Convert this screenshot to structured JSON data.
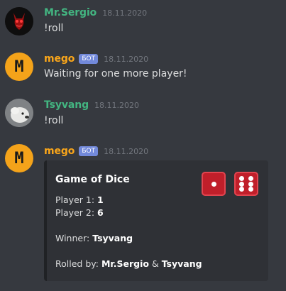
{
  "messages": [
    {
      "username": "Mr.Sergio",
      "username_color": "#43b581",
      "timestamp": "18.11.2020",
      "text": "!roll"
    },
    {
      "username": "mego",
      "username_color": "#faa61a",
      "bot_badge": "БОТ",
      "timestamp": "18.11.2020",
      "text": "Waiting for one more player!"
    },
    {
      "username": "Tsyvang",
      "username_color": "#43b581",
      "timestamp": "18.11.2020",
      "text": "!roll"
    },
    {
      "username": "mego",
      "username_color": "#faa61a",
      "bot_badge": "БОТ",
      "timestamp": "18.11.2020"
    }
  ],
  "embed": {
    "title": "Game of Dice",
    "player1_label": "Player 1: ",
    "player1_value": "1",
    "player2_label": "Player 2: ",
    "player2_value": "6",
    "winner_label": "Winner: ",
    "winner_value": "Tsyvang",
    "rolled_by_label": "Rolled by: ",
    "rolled_by_user1": "Mr.Sergio",
    "rolled_by_sep": " & ",
    "rolled_by_user2": "Tsyvang",
    "dice_values": [
      1,
      6
    ],
    "dice_color": "#c01f2a"
  },
  "avatars": {
    "mego_letter": "M",
    "mego_bg": "#f4a31a"
  }
}
